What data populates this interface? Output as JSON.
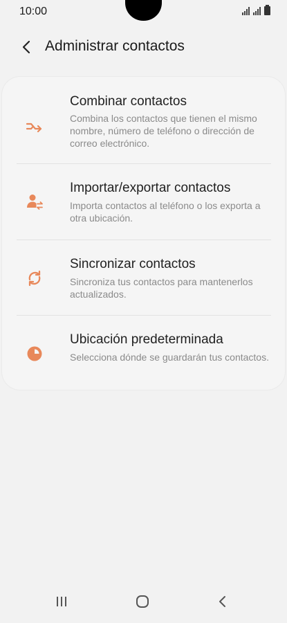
{
  "status_bar": {
    "time": "10:00"
  },
  "header": {
    "title": "Administrar contactos"
  },
  "menu": {
    "items": [
      {
        "title": "Combinar contactos",
        "description": "Combina los contactos que tienen el mismo nombre, número de teléfono o dirección de correo electrónico.",
        "icon": "merge-icon"
      },
      {
        "title": "Importar/exportar contactos",
        "description": "Importa contactos al teléfono o los exporta a otra ubicación.",
        "icon": "import-export-contact-icon"
      },
      {
        "title": "Sincronizar contactos",
        "description": "Sincroniza tus contactos para mantenerlos actualizados.",
        "icon": "sync-icon"
      },
      {
        "title": "Ubicación predeterminada",
        "description": "Selecciona dónde se guardarán tus contactos.",
        "icon": "storage-pie-icon"
      }
    ]
  },
  "colors": {
    "accent": "#e8885a",
    "background": "#f2f2f2",
    "title_text": "#1f1f1f",
    "description_text": "#8a8a8a"
  }
}
